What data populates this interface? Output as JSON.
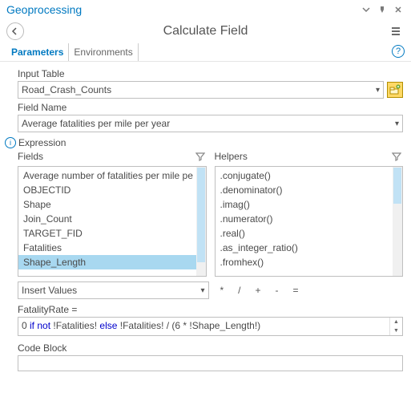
{
  "window": {
    "title": "Geoprocessing"
  },
  "tool": {
    "title": "Calculate Field"
  },
  "tabs": {
    "parameters": "Parameters",
    "environments": "Environments"
  },
  "labels": {
    "inputTable": "Input Table",
    "fieldName": "Field Name",
    "expression": "Expression",
    "fields": "Fields",
    "helpers": "Helpers",
    "insertValues": "Insert Values",
    "exprLabel": "FatalityRate =",
    "codeBlock": "Code Block"
  },
  "inputTable": {
    "value": "Road_Crash_Counts"
  },
  "fieldName": {
    "value": "Average fatalities per mile per year"
  },
  "fieldsList": {
    "items": [
      "Average number of fatalities per mile pe",
      "OBJECTID",
      "Shape",
      "Join_Count",
      "TARGET_FID",
      "Fatalities",
      "Shape_Length"
    ],
    "selectedIndex": 6
  },
  "helpersList": {
    "items": [
      ".conjugate()",
      ".denominator()",
      ".imag()",
      ".numerator()",
      ".real()",
      ".as_integer_ratio()",
      ".fromhex()"
    ]
  },
  "operators": {
    "mul": "*",
    "div": "/",
    "add": "+",
    "sub": "-",
    "eq": "="
  },
  "expression": {
    "tokens": [
      {
        "t": "0 ",
        "k": false
      },
      {
        "t": "if not",
        "k": true
      },
      {
        "t": " !Fatalities! ",
        "k": false
      },
      {
        "t": "else",
        "k": true
      },
      {
        "t": " !Fatalities! / (6 * !Shape_Length!)",
        "k": false
      }
    ]
  }
}
